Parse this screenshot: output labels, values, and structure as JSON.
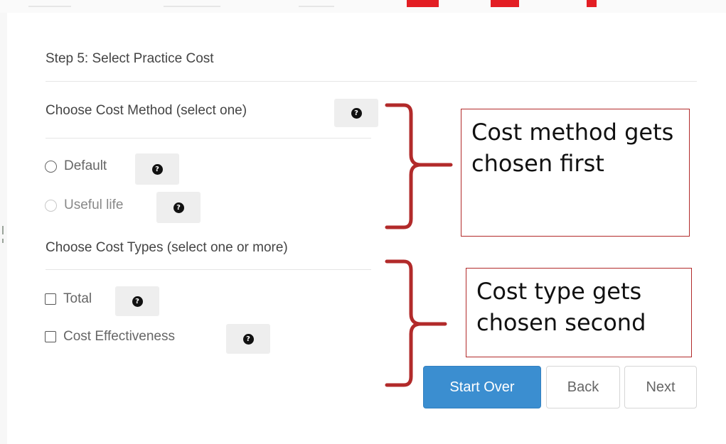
{
  "panel": {
    "step_title": "Step 5: Select Practice Cost",
    "cost_method": {
      "title": "Choose Cost Method (select one)",
      "options": [
        {
          "label": "Default",
          "state": "enabled",
          "selected": false
        },
        {
          "label": "Useful life",
          "state": "disabled",
          "selected": false
        }
      ]
    },
    "cost_types": {
      "title": "Choose Cost Types (select one or more)",
      "options": [
        {
          "label": "Total",
          "checked": false
        },
        {
          "label": "Cost Effectiveness",
          "checked": false
        }
      ]
    },
    "buttons": {
      "start_over": "Start Over",
      "back": "Back",
      "next": "Next"
    }
  },
  "annotations": {
    "method_callout": "Cost method gets chosen first",
    "type_callout": "Cost type gets chosen second"
  },
  "colors": {
    "primary_button": "#3b8ed0",
    "annotation_red": "#b22a2a",
    "help_icon": "#111111"
  },
  "icons": {
    "help": "question-circle-icon"
  }
}
